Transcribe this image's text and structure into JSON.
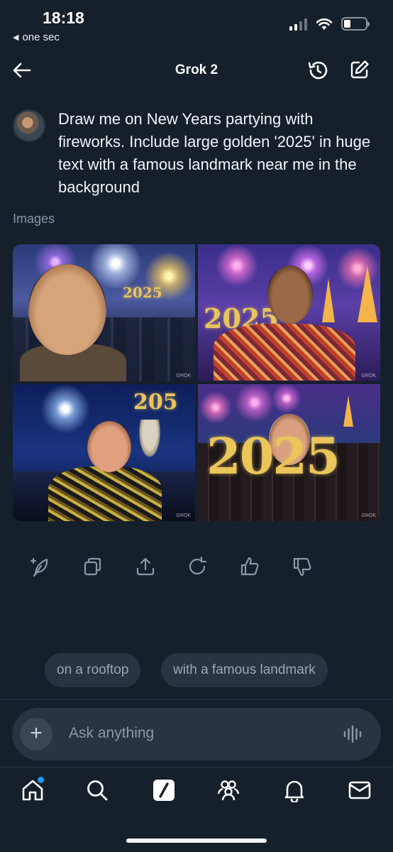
{
  "status_bar": {
    "time": "18:18",
    "back_app": "one sec"
  },
  "header": {
    "title": "Grok 2"
  },
  "message": {
    "text": "Draw me on New Years partying with fireworks. Include large golden '2025' in huge text with a famous landmark near me in the background"
  },
  "images_section": {
    "label": "Images",
    "tiles": [
      {
        "caption": "2025"
      },
      {
        "caption": "2025"
      },
      {
        "caption": "205"
      },
      {
        "caption": "2025"
      }
    ]
  },
  "suggestions": [
    "on a rooftop",
    "with a famous landmark"
  ],
  "input": {
    "placeholder": "Ask anything"
  },
  "colors": {
    "background": "#16202b",
    "surface": "#283441",
    "accent": "#1d9bf0",
    "gold": "#e9c55a"
  },
  "icons": {
    "actions": [
      "edit-image-icon",
      "copy-icon",
      "share-icon",
      "regenerate-icon",
      "thumbs-up-icon",
      "thumbs-down-icon"
    ],
    "nav": [
      "home-icon",
      "search-icon",
      "grok-icon",
      "communities-icon",
      "notifications-icon",
      "messages-icon"
    ]
  }
}
